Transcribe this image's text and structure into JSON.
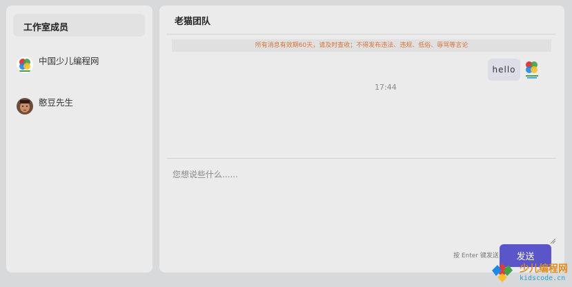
{
  "sidebar": {
    "header": "工作室成员",
    "members": [
      {
        "name": "中国少儿编程网",
        "avatar": "kidscode-logo-icon"
      },
      {
        "name": "憨豆先生",
        "avatar": "user-photo-avatar"
      }
    ]
  },
  "chat": {
    "title": "老猫团队",
    "notice": "所有消息有效期60天，请及时查收；不得发布违法、违规、低俗、辱骂等言论",
    "messages": [
      {
        "text": "hello",
        "sender": "self",
        "avatar": "kidscode-logo-icon"
      }
    ],
    "timestamp": "17:44",
    "input": {
      "placeholder": "您想说些什么......",
      "value": ""
    },
    "hint": "按 Enter 键发送",
    "send_label": "发送"
  },
  "watermark": {
    "line1": "少儿编程网",
    "line2": "kidscode.cn"
  },
  "colors": {
    "accent": "#5a55c8",
    "notice_text": "#d9733a",
    "background": "#d7d9db",
    "panel": "#ebebeb"
  }
}
